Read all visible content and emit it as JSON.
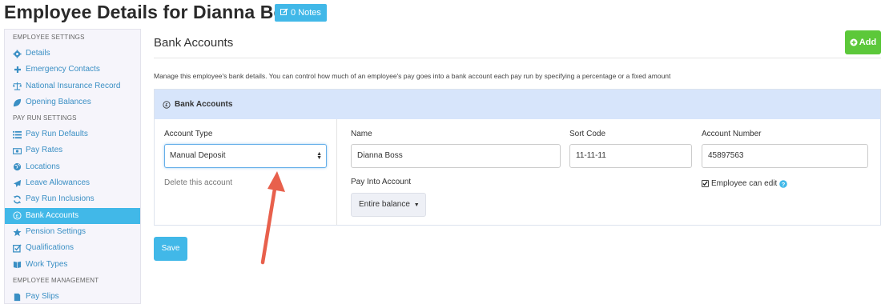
{
  "header": {
    "title": "Employee Details for Dianna Boss",
    "notes_label": "0 Notes"
  },
  "sidebar": {
    "sections": [
      {
        "title": "EMPLOYEE SETTINGS",
        "items": [
          {
            "label": "Details",
            "icon": "gear-icon"
          },
          {
            "label": "Emergency Contacts",
            "icon": "plus-icon"
          },
          {
            "label": "National Insurance Record",
            "icon": "balance-scale-icon"
          },
          {
            "label": "Opening Balances",
            "icon": "leaf-icon"
          }
        ]
      },
      {
        "title": "PAY RUN SETTINGS",
        "items": [
          {
            "label": "Pay Run Defaults",
            "icon": "list-icon"
          },
          {
            "label": "Pay Rates",
            "icon": "money-icon"
          },
          {
            "label": "Locations",
            "icon": "globe-icon"
          },
          {
            "label": "Leave Allowances",
            "icon": "plane-icon"
          },
          {
            "label": "Pay Run Inclusions",
            "icon": "refresh-icon"
          },
          {
            "label": "Bank Accounts",
            "icon": "pound-circle-icon",
            "active": true
          },
          {
            "label": "Pension Settings",
            "icon": "star-icon"
          },
          {
            "label": "Qualifications",
            "icon": "check-square-icon"
          },
          {
            "label": "Work Types",
            "icon": "book-icon"
          }
        ]
      },
      {
        "title": "EMPLOYEE MANAGEMENT",
        "items": [
          {
            "label": "Pay Slips",
            "icon": "file-icon"
          }
        ]
      }
    ]
  },
  "main": {
    "title": "Bank Accounts",
    "add_label": "Add",
    "description": "Manage this employee's bank details. You can control how much of an employee's pay goes into a bank account each pay run by specifying a percentage or a fixed amount",
    "panel_title": "Bank Accounts",
    "account_type_label": "Account Type",
    "account_type_value": "Manual Deposit",
    "delete_label": "Delete this account",
    "name_label": "Name",
    "name_value": "Dianna Boss",
    "sort_code_label": "Sort Code",
    "sort_code_value": "11-11-11",
    "account_number_label": "Account Number",
    "account_number_value": "45897563",
    "pay_into_label": "Pay Into Account",
    "pay_into_value": "Entire balance",
    "employee_can_edit_label": "Employee can edit",
    "employee_can_edit_checked": true,
    "save_label": "Save"
  },
  "colors": {
    "accent": "#41b8e8",
    "add_green": "#5cc83a",
    "panel_header": "#d7e5fb",
    "link": "#3a8fc4",
    "annotation_arrow": "#e8604c"
  }
}
